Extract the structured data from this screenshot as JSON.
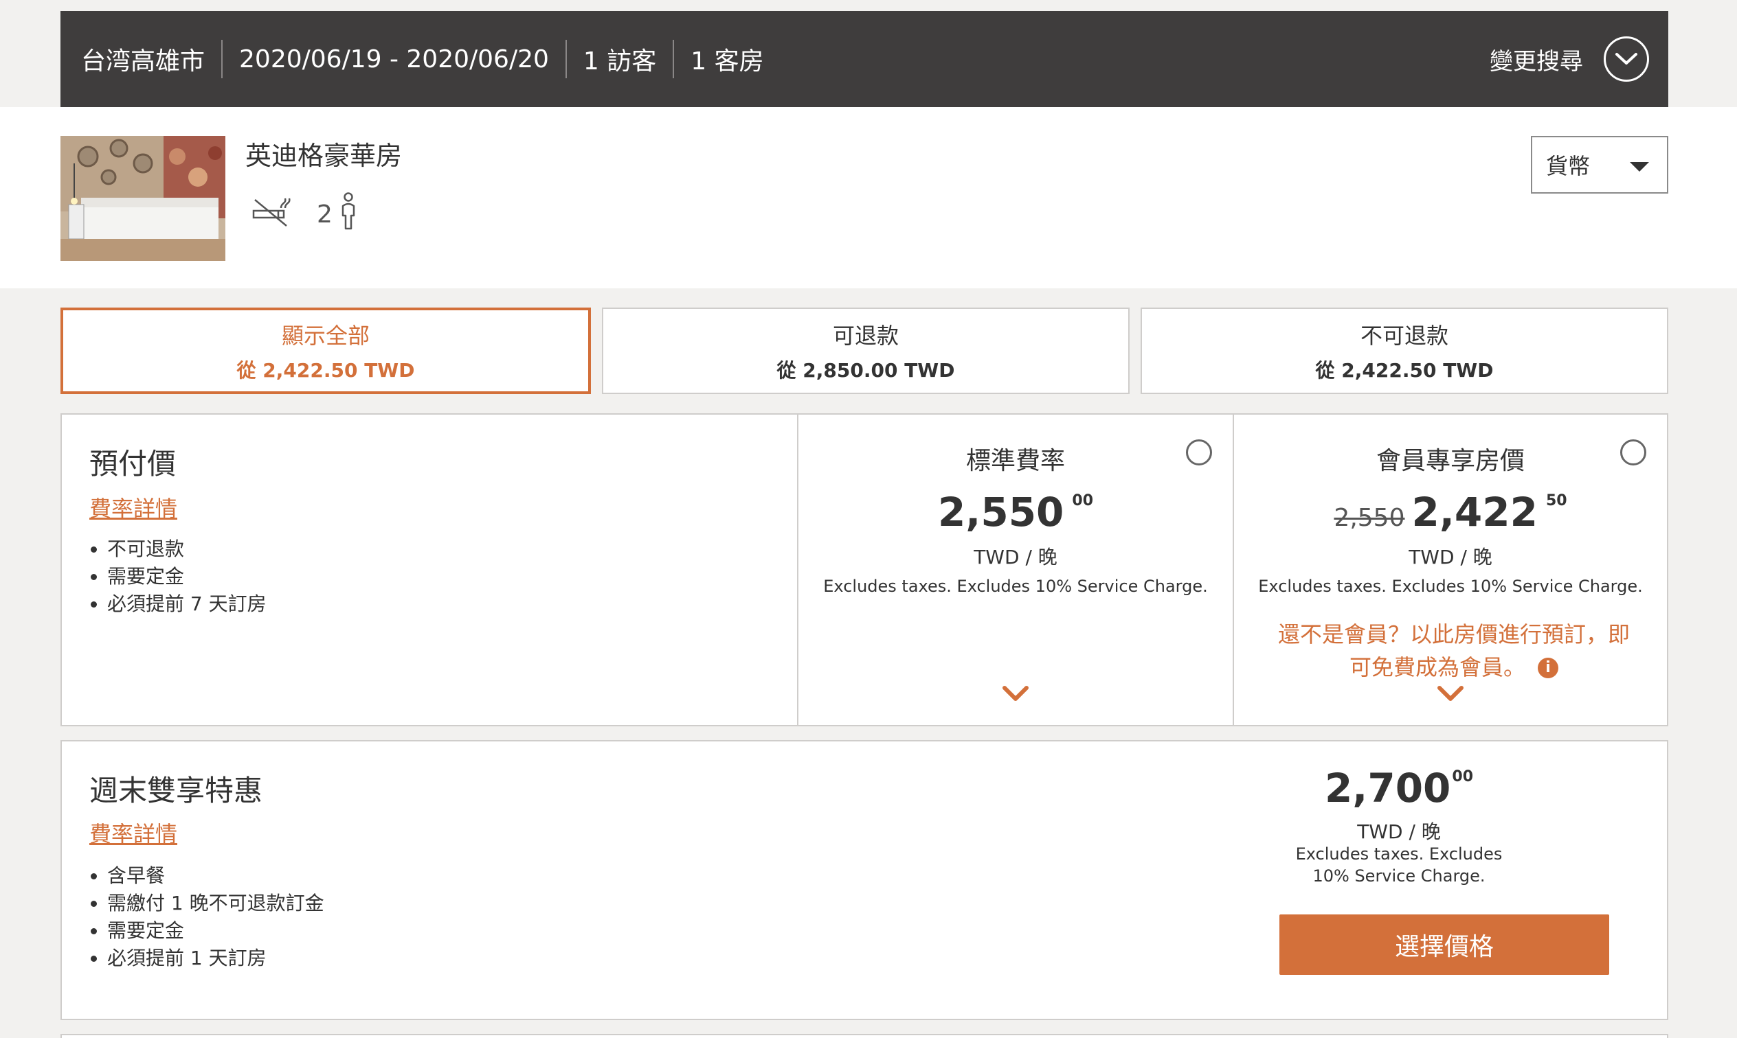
{
  "search_bar": {
    "location": "台湾高雄市",
    "dates": "2020/06/19 - 2020/06/20",
    "guests": "1 訪客",
    "rooms": "1 客房",
    "change_label": "變更搜尋"
  },
  "room": {
    "name": "英迪格豪華房",
    "occupancy": "2",
    "icons": [
      "no-smoking-icon",
      "person-icon"
    ]
  },
  "currency": {
    "label": "貨幣"
  },
  "tabs": [
    {
      "label": "顯示全部",
      "price": "從 2,422.50 TWD",
      "active": true
    },
    {
      "label": "可退款",
      "price": "從 2,850.00 TWD",
      "active": false
    },
    {
      "label": "不可退款",
      "price": "從 2,422.50 TWD",
      "active": false
    }
  ],
  "prepaid": {
    "title": "預付價",
    "link": "費率詳情",
    "features": [
      "不可退款",
      "需要定金",
      "必須提前 7 天訂房"
    ],
    "standard": {
      "title": "標準費率",
      "price": "2,550",
      "cents": "00",
      "unit": "TWD / 晚",
      "note": "Excludes taxes. Excludes 10% Service Charge."
    },
    "member": {
      "title": "會員專享房價",
      "old_price": "2,550",
      "price": "2,422",
      "cents": "50",
      "unit": "TWD / 晚",
      "note": "Excludes taxes. Excludes 10% Service Charge.",
      "promo_line1": "還不是會員？以此房價進行預訂，即",
      "promo_line2": "可免費成為會員。"
    }
  },
  "weekend": {
    "title": "週末雙享特惠",
    "link": "費率詳情",
    "features": [
      "含早餐",
      "需繳付 1 晚不可退款訂金",
      "需要定金",
      "必須提前 1 天訂房"
    ],
    "price": "2,700",
    "cents": "00",
    "unit": "TWD / 晚",
    "note": "Excludes taxes. Excludes 10% Service Charge.",
    "button": "選擇價格"
  },
  "colors": {
    "accent": "#d3703a",
    "topbar": "#3f3d3d",
    "page_bg": "#f2f1ef"
  }
}
